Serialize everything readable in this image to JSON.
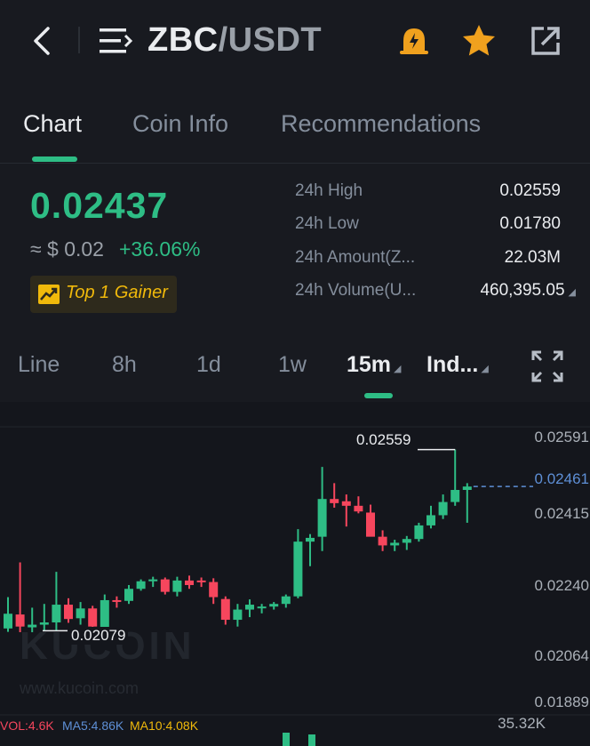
{
  "header": {
    "pair_base": "ZBC",
    "pair_sep_quote": "/USDT",
    "icons": [
      "back-arrow-icon",
      "menu-icon",
      "price-alert-bell-icon",
      "favorite-star-icon",
      "share-icon"
    ]
  },
  "tabs": [
    {
      "label": "Chart",
      "active": true
    },
    {
      "label": "Coin Info",
      "active": false
    },
    {
      "label": "Recommendations",
      "active": false
    }
  ],
  "ticker": {
    "last_price": "0.02437",
    "usd_approx": "≈ $ 0.02",
    "change_pct": "+36.06%",
    "badge": "Top 1 Gainer"
  },
  "stats": [
    {
      "label": "24h High",
      "value": "0.02559"
    },
    {
      "label": "24h Low",
      "value": "0.01780"
    },
    {
      "label": "24h Amount(Z...",
      "value": "22.03M"
    },
    {
      "label": "24h Volume(U...",
      "value": "460,395.05"
    }
  ],
  "timeframes": [
    {
      "label": "Line"
    },
    {
      "label": "8h"
    },
    {
      "label": "1d"
    },
    {
      "label": "1w"
    },
    {
      "label": "15m",
      "active": true
    },
    {
      "label": "Ind..."
    }
  ],
  "colors": {
    "up": "#2ebd85",
    "down": "#f6465d",
    "background": "#181a20",
    "accent": "#f0b90b",
    "current_price_line": "#5e8fd6"
  },
  "chart_data": {
    "type": "candlestick",
    "y_axis_labels": [
      "0.02591",
      "0.02461",
      "0.02415",
      "0.02240",
      "0.02064",
      "0.01889"
    ],
    "current_price_label": "0.02461",
    "high_marker": "0.02559",
    "low_marker": "0.02079",
    "ylim": [
      0.01889,
      0.02591
    ],
    "candles": [
      {
        "o": 0.02085,
        "h": 0.02168,
        "l": 0.02076,
        "c": 0.02124
      },
      {
        "o": 0.02122,
        "h": 0.0226,
        "l": 0.02075,
        "c": 0.0209
      },
      {
        "o": 0.02088,
        "h": 0.0214,
        "l": 0.02075,
        "c": 0.02095
      },
      {
        "o": 0.02095,
        "h": 0.0215,
        "l": 0.0208,
        "c": 0.02101
      },
      {
        "o": 0.02101,
        "h": 0.02235,
        "l": 0.0208,
        "c": 0.02148
      },
      {
        "o": 0.02148,
        "h": 0.02165,
        "l": 0.021,
        "c": 0.0211
      },
      {
        "o": 0.02112,
        "h": 0.02155,
        "l": 0.02095,
        "c": 0.02138
      },
      {
        "o": 0.02138,
        "h": 0.02145,
        "l": 0.0208,
        "c": 0.0209
      },
      {
        "o": 0.02088,
        "h": 0.02175,
        "l": 0.0208,
        "c": 0.0216
      },
      {
        "o": 0.0216,
        "h": 0.0217,
        "l": 0.0214,
        "c": 0.02158
      },
      {
        "o": 0.02158,
        "h": 0.022,
        "l": 0.0215,
        "c": 0.0219
      },
      {
        "o": 0.0219,
        "h": 0.02215,
        "l": 0.02185,
        "c": 0.0221
      },
      {
        "o": 0.0221,
        "h": 0.02222,
        "l": 0.02195,
        "c": 0.02215
      },
      {
        "o": 0.02215,
        "h": 0.0222,
        "l": 0.02175,
        "c": 0.02182
      },
      {
        "o": 0.02182,
        "h": 0.02222,
        "l": 0.0217,
        "c": 0.02212
      },
      {
        "o": 0.02212,
        "h": 0.02225,
        "l": 0.0219,
        "c": 0.022
      },
      {
        "o": 0.02212,
        "h": 0.0222,
        "l": 0.02195,
        "c": 0.02208
      },
      {
        "o": 0.02208,
        "h": 0.02218,
        "l": 0.0215,
        "c": 0.02168
      },
      {
        "o": 0.02163,
        "h": 0.0217,
        "l": 0.02095,
        "c": 0.02108
      },
      {
        "o": 0.02108,
        "h": 0.0215,
        "l": 0.0209,
        "c": 0.02135
      },
      {
        "o": 0.02135,
        "h": 0.02162,
        "l": 0.02115,
        "c": 0.02148
      },
      {
        "o": 0.0214,
        "h": 0.0215,
        "l": 0.02125,
        "c": 0.02143
      },
      {
        "o": 0.02143,
        "h": 0.02155,
        "l": 0.02135,
        "c": 0.0215
      },
      {
        "o": 0.0215,
        "h": 0.02175,
        "l": 0.0214,
        "c": 0.0217
      },
      {
        "o": 0.0217,
        "h": 0.02348,
        "l": 0.02165,
        "c": 0.02315
      },
      {
        "o": 0.02315,
        "h": 0.02335,
        "l": 0.0225,
        "c": 0.02325
      },
      {
        "o": 0.02328,
        "h": 0.02513,
        "l": 0.0229,
        "c": 0.02428
      },
      {
        "o": 0.02428,
        "h": 0.0247,
        "l": 0.02405,
        "c": 0.02417
      },
      {
        "o": 0.02422,
        "h": 0.0244,
        "l": 0.02355,
        "c": 0.0241
      },
      {
        "o": 0.0241,
        "h": 0.02435,
        "l": 0.0239,
        "c": 0.02395
      },
      {
        "o": 0.02392,
        "h": 0.02413,
        "l": 0.02362,
        "c": 0.02328
      },
      {
        "o": 0.02328,
        "h": 0.02345,
        "l": 0.0229,
        "c": 0.02305
      },
      {
        "o": 0.02305,
        "h": 0.0232,
        "l": 0.0229,
        "c": 0.02312
      },
      {
        "o": 0.02312,
        "h": 0.0233,
        "l": 0.02293,
        "c": 0.02322
      },
      {
        "o": 0.02322,
        "h": 0.02365,
        "l": 0.02315,
        "c": 0.02358
      },
      {
        "o": 0.02358,
        "h": 0.0241,
        "l": 0.0235,
        "c": 0.02385
      },
      {
        "o": 0.02385,
        "h": 0.0244,
        "l": 0.02375,
        "c": 0.0242
      },
      {
        "o": 0.0242,
        "h": 0.02559,
        "l": 0.0241,
        "c": 0.02452
      },
      {
        "o": 0.02452,
        "h": 0.0247,
        "l": 0.02365,
        "c": 0.02461
      }
    ]
  },
  "volume": {
    "vol": "VOL:4.6K",
    "ma5": "MA5:4.86K",
    "ma10": "MA10:4.08K",
    "axis_max": "35.32K"
  },
  "watermark": {
    "brand": "KUCOIN",
    "url": "www.kucoin.com"
  }
}
